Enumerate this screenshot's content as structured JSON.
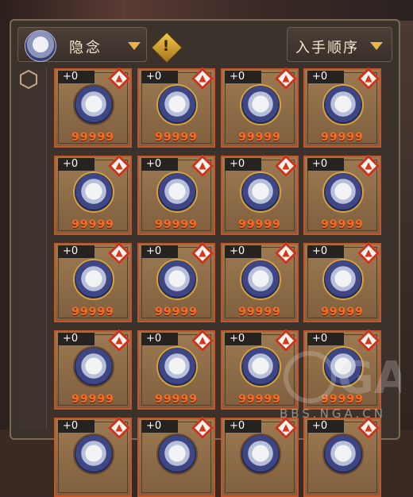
{
  "header": {
    "filter_label": "隐念",
    "sort_label": "入手顺序"
  },
  "cards": [
    {
      "plus": "+0",
      "value": "99999",
      "frame": "plain"
    },
    {
      "plus": "+0",
      "value": "99999",
      "frame": "gold"
    },
    {
      "plus": "+0",
      "value": "99999",
      "frame": "gold"
    },
    {
      "plus": "+0",
      "value": "99999",
      "frame": "gold"
    },
    {
      "plus": "+0",
      "value": "99999",
      "frame": "gold"
    },
    {
      "plus": "+0",
      "value": "99999",
      "frame": "gold"
    },
    {
      "plus": "+0",
      "value": "99999",
      "frame": "gold"
    },
    {
      "plus": "+0",
      "value": "99999",
      "frame": "gold"
    },
    {
      "plus": "+0",
      "value": "99999",
      "frame": "gold"
    },
    {
      "plus": "+0",
      "value": "99999",
      "frame": "gold"
    },
    {
      "plus": "+0",
      "value": "99999",
      "frame": "gold"
    },
    {
      "plus": "+0",
      "value": "99999",
      "frame": "gold"
    },
    {
      "plus": "+0",
      "value": "99999",
      "frame": "plain"
    },
    {
      "plus": "+0",
      "value": "99999",
      "frame": "gold"
    },
    {
      "plus": "+0",
      "value": "99999",
      "frame": "gold"
    },
    {
      "plus": "+0",
      "value": "99999",
      "frame": "gold"
    },
    {
      "plus": "+0",
      "value": "",
      "frame": "plain"
    },
    {
      "plus": "+0",
      "value": "",
      "frame": "plain"
    },
    {
      "plus": "+0",
      "value": "",
      "frame": "plain"
    },
    {
      "plus": "+0",
      "value": "",
      "frame": "plain"
    }
  ],
  "watermark": "BBS.NGA.CN",
  "colors": {
    "card_border": "#c4552a",
    "value_text": "#ff6a1c",
    "lock_red": "#c9331b",
    "accent_gold": "#e8b54a"
  },
  "icons": {
    "lock": "lock-icon",
    "warning": "warning-icon",
    "filter_arrow": "chevron-down-icon"
  }
}
